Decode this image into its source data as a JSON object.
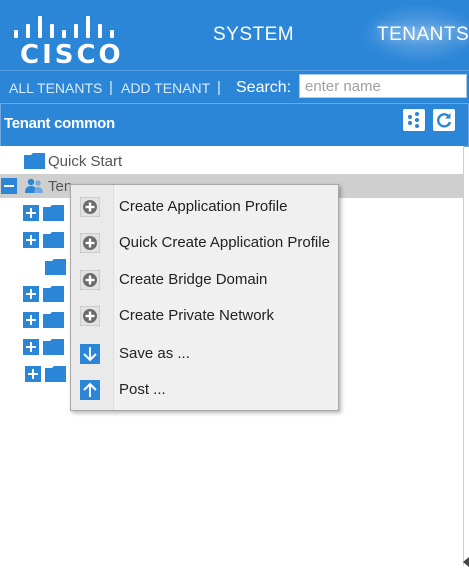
{
  "header": {
    "logo_text": "CISCO",
    "nav": [
      {
        "label": "SYSTEM",
        "active": false
      },
      {
        "label": "TENANTS",
        "active": true
      }
    ]
  },
  "subnav": {
    "all_tenants": "ALL TENANTS",
    "add_tenant": "ADD TENANT",
    "separator": "|",
    "search_label": "Search:",
    "search_placeholder": "enter name"
  },
  "panel": {
    "title": "Tenant common",
    "tools": [
      "topology-icon",
      "refresh-icon"
    ]
  },
  "tree": {
    "quick_start": "Quick Start",
    "tenant_row_label": "Ten"
  },
  "context_menu": {
    "items": [
      {
        "label": "Create Application Profile",
        "icon": "plus-circle-icon"
      },
      {
        "label": "Quick Create Application Profile",
        "icon": "plus-circle-icon"
      },
      {
        "label": "Create Bridge Domain",
        "icon": "plus-circle-icon"
      },
      {
        "label": "Create Private Network",
        "icon": "plus-circle-icon"
      },
      {
        "label": "Save as ...",
        "icon": "arrow-down-icon"
      },
      {
        "label": "Post ...",
        "icon": "arrow-up-icon"
      }
    ]
  },
  "colors": {
    "brand_blue": "#2c86d8",
    "selection_gray": "#cfcfcf",
    "menu_bg": "#f0f0f0"
  }
}
